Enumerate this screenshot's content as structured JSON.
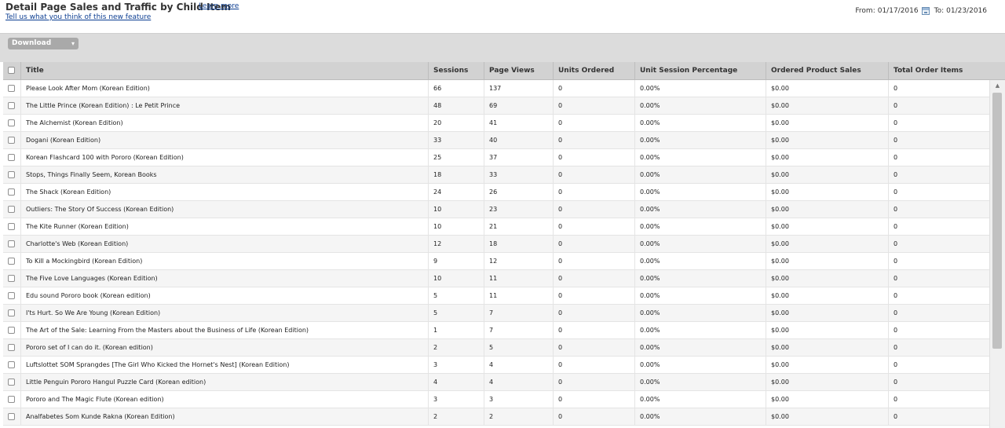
{
  "header": {
    "title": "Detail Page Sales and Traffic by Child Item",
    "learn_more": "Learn more",
    "feedback": "Tell us what you think of this new feature",
    "from_label": "From:",
    "from_date": "01/17/2016",
    "to_label": "To:",
    "to_date": "01/23/2016"
  },
  "toolbar": {
    "download_label": "Download",
    "download_chevron": "▾"
  },
  "table": {
    "columns": [
      "Title",
      "Sessions",
      "Page Views",
      "Units Ordered",
      "Unit Session Percentage",
      "Ordered Product Sales",
      "Total Order Items"
    ],
    "rows": [
      [
        "Please Look After Mom (Korean Edition)",
        "66",
        "137",
        "0",
        "0.00%",
        "$0.00",
        "0"
      ],
      [
        "The Little Prince (Korean Edition) : Le Petit Prince",
        "48",
        "69",
        "0",
        "0.00%",
        "$0.00",
        "0"
      ],
      [
        "The Alchemist (Korean Edition)",
        "20",
        "41",
        "0",
        "0.00%",
        "$0.00",
        "0"
      ],
      [
        "Dogani (Korean Edition)",
        "33",
        "40",
        "0",
        "0.00%",
        "$0.00",
        "0"
      ],
      [
        "Korean Flashcard 100 with Pororo (Korean Edition)",
        "25",
        "37",
        "0",
        "0.00%",
        "$0.00",
        "0"
      ],
      [
        "Stops, Things Finally Seem, Korean Books",
        "18",
        "33",
        "0",
        "0.00%",
        "$0.00",
        "0"
      ],
      [
        "The Shack (Korean Edition)",
        "24",
        "26",
        "0",
        "0.00%",
        "$0.00",
        "0"
      ],
      [
        "Outliers: The Story Of Success (Korean Edition)",
        "10",
        "23",
        "0",
        "0.00%",
        "$0.00",
        "0"
      ],
      [
        "The Kite Runner (Korean Edition)",
        "10",
        "21",
        "0",
        "0.00%",
        "$0.00",
        "0"
      ],
      [
        "Charlotte's Web (Korean Edition)",
        "12",
        "18",
        "0",
        "0.00%",
        "$0.00",
        "0"
      ],
      [
        "To Kill a Mockingbird (Korean Edition)",
        "9",
        "12",
        "0",
        "0.00%",
        "$0.00",
        "0"
      ],
      [
        "The Five Love Languages (Korean Edition)",
        "10",
        "11",
        "0",
        "0.00%",
        "$0.00",
        "0"
      ],
      [
        "Edu sound Pororo book (Korean edition)",
        "5",
        "11",
        "0",
        "0.00%",
        "$0.00",
        "0"
      ],
      [
        "I'ts Hurt. So We Are Young (Korean Edition)",
        "5",
        "7",
        "0",
        "0.00%",
        "$0.00",
        "0"
      ],
      [
        "The Art of the Sale: Learning From the Masters about the Business of Life (Korean Edition)",
        "1",
        "7",
        "0",
        "0.00%",
        "$0.00",
        "0"
      ],
      [
        "Pororo set of I can do it. (Korean edition)",
        "2",
        "5",
        "0",
        "0.00%",
        "$0.00",
        "0"
      ],
      [
        "Luftslottet SOM Sprangdes [The Girl Who Kicked the Hornet's Nest] (Korean Edition)",
        "3",
        "4",
        "0",
        "0.00%",
        "$0.00",
        "0"
      ],
      [
        "Little Penguin Pororo Hangul Puzzle Card (Korean edition)",
        "4",
        "4",
        "0",
        "0.00%",
        "$0.00",
        "0"
      ],
      [
        "Pororo and The Magic Flute (Korean edition)",
        "3",
        "3",
        "0",
        "0.00%",
        "$0.00",
        "0"
      ],
      [
        "Analfabetes Som Kunde Rakna (Korean Edition)",
        "2",
        "2",
        "0",
        "0.00%",
        "$0.00",
        "0"
      ]
    ]
  },
  "scrollbar": {
    "up_arrow": "▲"
  }
}
